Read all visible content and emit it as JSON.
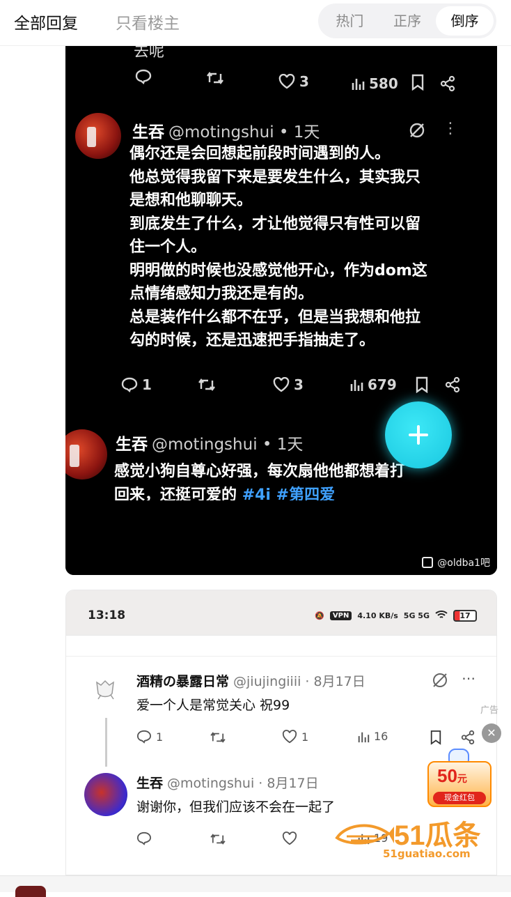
{
  "header": {
    "tab_all": "全部回复",
    "tab_op": "只看楼主",
    "sort": [
      "热门",
      "正序",
      "倒序"
    ],
    "sort_active": "倒序"
  },
  "dark_card": {
    "cut_text": "去呢",
    "top_actions": {
      "likes": "3",
      "views": "580"
    },
    "post1": {
      "name": "生吞",
      "handle": "@motingshui • 1天",
      "lines": [
        "偶尔还是会回想起前段时间遇到的人。",
        "他总觉得我留下来是要发生什么，其实我只",
        "是想和他聊聊天。",
        "到底发生了什么，才让他觉得只有性可以留",
        "住一个人。",
        "明明做的时候也没感觉他开心，作为dom这",
        "点情绪感知力我还是有的。",
        "总是装作什么都不在乎，但是当我想和他拉",
        "勾的时候，还是迅速把手指抽走了。"
      ],
      "replies": "1",
      "likes": "3",
      "views": "679"
    },
    "post2": {
      "name": "生吞",
      "handle": "@motingshui • 1天",
      "line1": "感觉小狗自尊心好强，每次扇他他都想着打",
      "line2": "回来，还挺可爱的",
      "tags": "#4i #第四爱"
    },
    "watermark": "@oldba1吧"
  },
  "light_card": {
    "status_time": "13:18",
    "status_vpn": "VPN",
    "status_speed": "4.10 KB/s",
    "status_net": "5G 5G",
    "battery": "17",
    "reply1": {
      "name": "酒精の暴露日常",
      "handle": "@jiujingiiii · 8月17日",
      "text": "爱一个人是常觉关心 祝99",
      "replies": "1",
      "likes": "1",
      "views": "16"
    },
    "reply2": {
      "name": "生吞",
      "handle": "@motingshui · 8月17日",
      "text": "谢谢你，但我们应该不会在一起了",
      "views": "19"
    }
  },
  "ad": {
    "tag": "广告",
    "close": "✕",
    "amount": "50",
    "unit": "元",
    "button": "现金红包"
  },
  "site": {
    "brand": "51瓜条",
    "url": "51guatiao.com"
  }
}
